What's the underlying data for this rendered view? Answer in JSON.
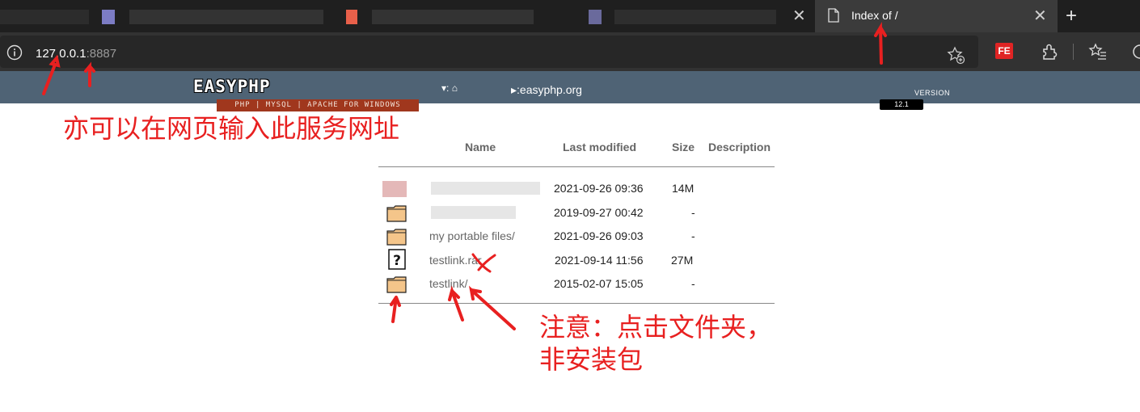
{
  "browser": {
    "active_tab_title": "Index of /",
    "url_host": "127.0.0.1",
    "url_port": ":8887",
    "extension_badge": "FE"
  },
  "easyphp": {
    "logo": "EASYPHP",
    "tagline": "PHP | MYSQL | APACHE FOR WINDOWS",
    "home_nav": "▾: ⌂",
    "site_link": "▸:easyphp.org",
    "version_label": "VERSION",
    "version": "12.1"
  },
  "listing": {
    "headers": {
      "name": "Name",
      "modified": "Last modified",
      "size": "Size",
      "description": "Description"
    },
    "rows": [
      {
        "name": "",
        "modified": "2021-09-26 09:36",
        "size": "14M"
      },
      {
        "name": "",
        "modified": "2019-09-27 00:42",
        "size": "-"
      },
      {
        "name": "my portable files/",
        "modified": "2021-09-26 09:03",
        "size": "-"
      },
      {
        "name": "testlink.rar",
        "modified": "2021-09-14 11:56",
        "size": "27M"
      },
      {
        "name": "testlink/",
        "modified": "2015-02-07 15:05",
        "size": "-"
      }
    ]
  },
  "annotations": {
    "note_address": "亦可以在网页输入此服务网址",
    "note_folder_line1": "注意：点击文件夹，",
    "note_folder_line2": "非安装包",
    "color": "#e82020"
  }
}
